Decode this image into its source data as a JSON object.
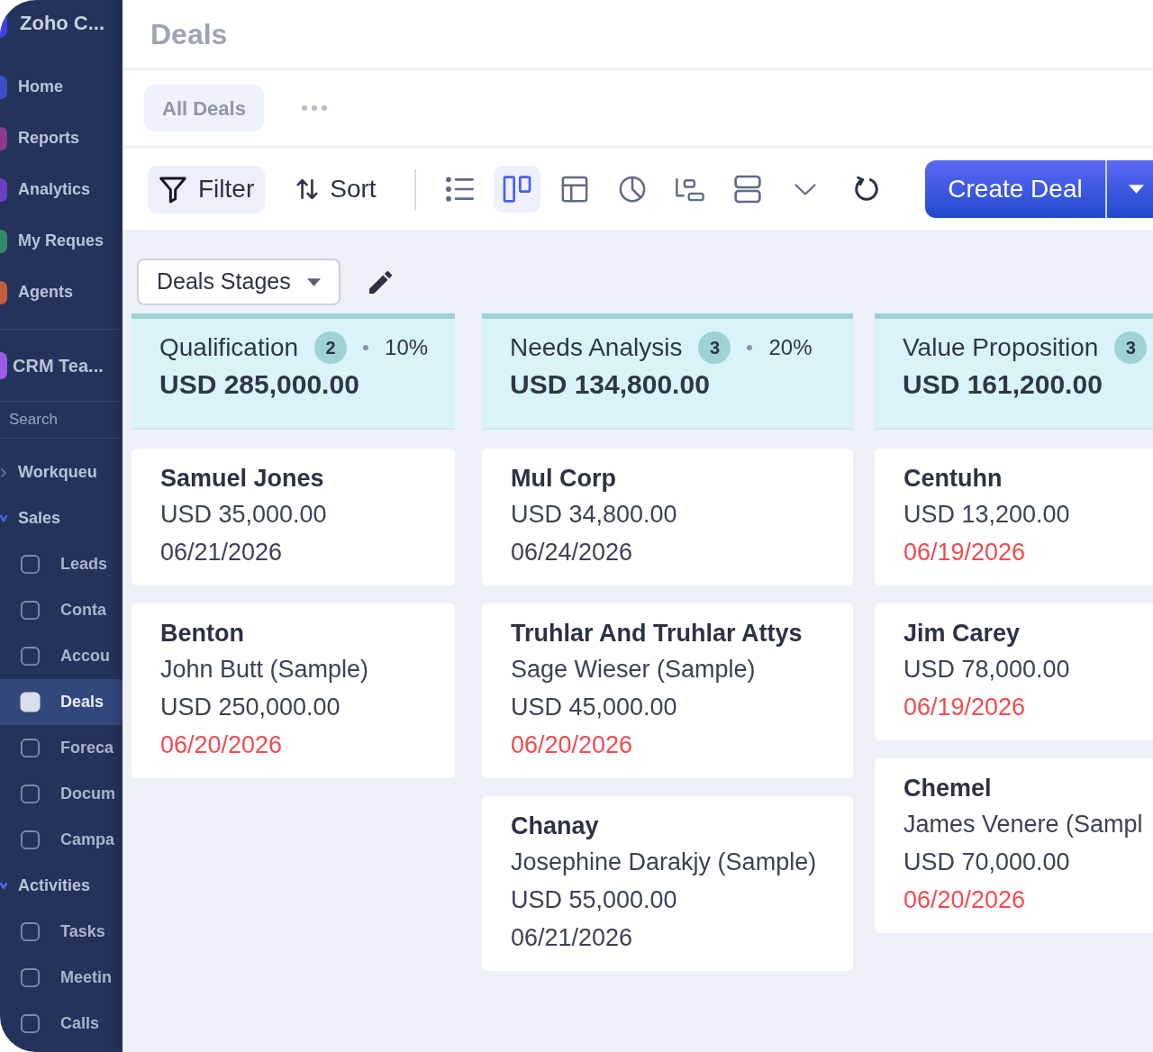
{
  "sidebar": {
    "brand": {
      "name": "Zoho C..."
    },
    "apps": [
      {
        "label": "Home",
        "color": "#3b4fc4"
      },
      {
        "label": "Reports",
        "color": "#8e3a8e"
      },
      {
        "label": "Analytics",
        "color": "#6a3fc0"
      },
      {
        "label": "My Reques",
        "color": "#2f8a6a"
      },
      {
        "label": "Agents",
        "color": "#c2603c"
      }
    ],
    "workspace": {
      "label": "CRM Tea...",
      "color": "#9c5ce8"
    },
    "search": {
      "placeholder": "Search"
    },
    "nav": [
      {
        "label": "Workqueu",
        "expanded": false
      },
      {
        "label": "Sales",
        "expanded": true,
        "children": [
          {
            "label": "Leads",
            "selected": false
          },
          {
            "label": "Conta",
            "selected": false
          },
          {
            "label": "Accou",
            "selected": false
          },
          {
            "label": "Deals",
            "selected": true
          },
          {
            "label": "Foreca",
            "selected": false
          },
          {
            "label": "Docum",
            "selected": false
          },
          {
            "label": "Campa",
            "selected": false
          }
        ]
      },
      {
        "label": "Activities",
        "expanded": true,
        "children": [
          {
            "label": "Tasks",
            "selected": false
          },
          {
            "label": "Meetin",
            "selected": false
          },
          {
            "label": "Calls",
            "selected": false
          }
        ]
      }
    ]
  },
  "header": {
    "title": "Deals"
  },
  "views": {
    "tabs": [
      {
        "label": "All Deals",
        "selected": true
      }
    ]
  },
  "toolbar": {
    "actions": [
      {
        "kind": "filter",
        "label": "Filter",
        "selected": true
      },
      {
        "kind": "sort",
        "label": "Sort",
        "selected": false
      }
    ],
    "view_modes": [
      {
        "kind": "list",
        "selected": false
      },
      {
        "kind": "kanban",
        "selected": true
      },
      {
        "kind": "table",
        "selected": false
      },
      {
        "kind": "chart",
        "selected": false
      },
      {
        "kind": "timeline",
        "selected": false
      },
      {
        "kind": "split",
        "selected": false
      }
    ],
    "create_button": {
      "label": "Create Deal"
    }
  },
  "board": {
    "layout_picker": {
      "value": "Deals Stages"
    },
    "columns": [
      {
        "name": "Qualification",
        "count": "2",
        "probability": "10%",
        "total": "USD 285,000.00",
        "cards": [
          {
            "title": "Samuel Jones",
            "amount": "USD 35,000.00",
            "date": "06/21/2026",
            "overdue": false
          },
          {
            "title": "Benton",
            "contact": "John Butt (Sample)",
            "amount": "USD 250,000.00",
            "date": "06/20/2026",
            "overdue": true
          }
        ]
      },
      {
        "name": "Needs Analysis",
        "count": "3",
        "probability": "20%",
        "total": "USD 134,800.00",
        "cards": [
          {
            "title": "Mul Corp",
            "amount": "USD 34,800.00",
            "date": "06/24/2026",
            "overdue": false
          },
          {
            "title": "Truhlar And Truhlar Attys",
            "contact": "Sage Wieser (Sample)",
            "amount": "USD 45,000.00",
            "date": "06/20/2026",
            "overdue": true
          },
          {
            "title": "Chanay",
            "contact": "Josephine Darakjy (Sample)",
            "amount": "USD 55,000.00",
            "date": "06/21/2026",
            "overdue": false
          }
        ]
      },
      {
        "name": "Value Proposition",
        "count": "3",
        "total": "USD 161,200.00",
        "cards": [
          {
            "title": "Centuhn",
            "amount": "USD 13,200.00",
            "date": "06/19/2026",
            "overdue": true
          },
          {
            "title": "Jim Carey",
            "amount": "USD 78,000.00",
            "date": "06/19/2026",
            "overdue": true
          },
          {
            "title": "Chemel",
            "contact": "James Venere (Sampl",
            "amount": "USD 70,000.00",
            "date": "06/20/2026",
            "overdue": true
          }
        ]
      }
    ]
  }
}
